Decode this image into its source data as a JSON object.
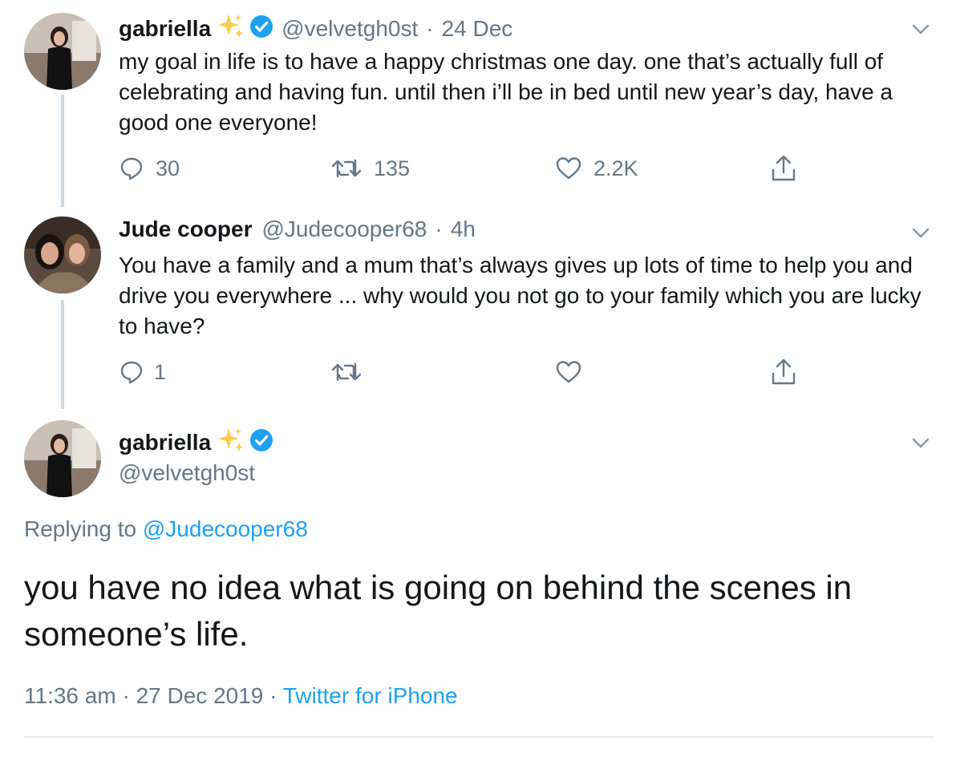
{
  "tweet1": {
    "name": "gabriella",
    "handle": "@velvetgh0st",
    "sep": "·",
    "time": "24 Dec",
    "text": "my goal in life is to have a happy christmas one day. one that’s actually full of celebrating and having fun. until then i’ll be in bed until new year’s day, have a good one everyone!",
    "replies": "30",
    "retweets": "135",
    "likes": "2.2K"
  },
  "tweet2": {
    "name": "Jude cooper",
    "handle": "@Judecooper68",
    "sep": "·",
    "time": "4h",
    "text": "You have a family and a mum that’s always gives up lots of time to help you  and drive you everywhere ... why would you not go to your family which you are lucky to have?",
    "replies": "1",
    "retweets": "",
    "likes": ""
  },
  "main_tweet": {
    "name": "gabriella",
    "handle": "@velvetgh0st",
    "replying_prefix": "Replying to",
    "replying_to": "@Judecooper68",
    "text": "you have no idea what is going on behind the scenes in someone’s life.",
    "time": "11:36 am",
    "sep": "·",
    "date": "27 Dec 2019",
    "sep2": "·",
    "source": "Twitter for iPhone"
  },
  "colors": {
    "accent": "#1da1f2",
    "muted": "#657786",
    "text": "#14171a",
    "thread": "#ccd6dd"
  },
  "icons": {
    "verified": "verified-badge-icon",
    "sparkle": "sparkles-icon",
    "reply": "reply-icon",
    "retweet": "retweet-icon",
    "like": "heart-icon",
    "share": "share-icon",
    "menu": "chevron-down-icon"
  }
}
